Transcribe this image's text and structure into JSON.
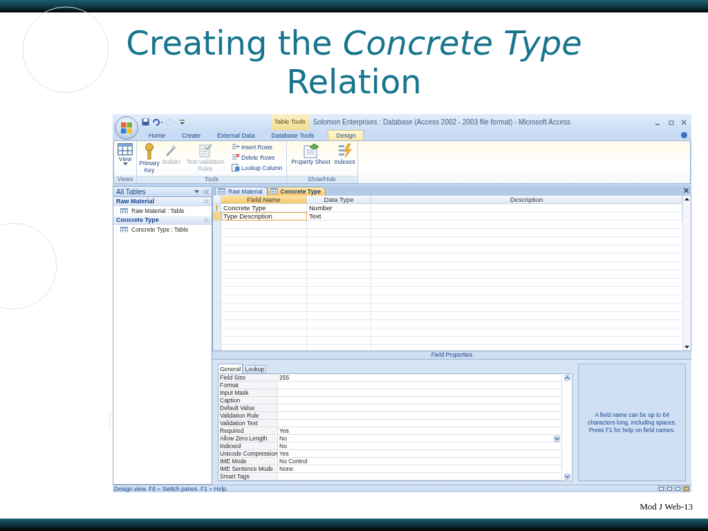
{
  "slide": {
    "title": "Creating the *Concrete Type* Relation",
    "footer": "Mod J Web-13"
  },
  "window": {
    "title": "Solomon Enterprises : Database (Access 2002 - 2003 file format) - Microsoft Access",
    "context_label": "Table Tools"
  },
  "quick_access": [
    {
      "kind": "save",
      "disabled": false
    },
    {
      "kind": "undo",
      "disabled": false
    },
    {
      "kind": "redo",
      "disabled": true
    },
    {
      "kind": "customize",
      "disabled": false
    }
  ],
  "ribbon_tabs": [
    {
      "label": "Home",
      "selected": false
    },
    {
      "label": "Create",
      "selected": false
    },
    {
      "label": "External Data",
      "selected": false
    },
    {
      "label": "Database Tools",
      "selected": false
    },
    {
      "label": "Design",
      "selected": true
    }
  ],
  "ribbon_groups": [
    {
      "label": "Views",
      "commands": [
        {
          "kind": "view",
          "label": "View",
          "disabled": false
        }
      ]
    },
    {
      "label": "Tools",
      "commands": [
        {
          "kind": "key",
          "label": "Primary Key",
          "disabled": false
        },
        {
          "kind": "builder",
          "label": "Builder",
          "disabled": true
        },
        {
          "kind": "validation",
          "label": "Test Validation Rules",
          "disabled": true
        },
        {
          "kind": "insert",
          "label": "Insert Rows",
          "disabled": false
        },
        {
          "kind": "delete",
          "label": "Delete Rows",
          "disabled": false
        },
        {
          "kind": "lookup",
          "label": "Lookup Column",
          "disabled": false
        }
      ]
    },
    {
      "label": "Show/Hide",
      "commands": [
        {
          "kind": "sheet",
          "label": "Property Sheet",
          "disabled": false
        },
        {
          "kind": "indexes",
          "label": "Indexes",
          "disabled": false
        }
      ]
    }
  ],
  "nav_pane": {
    "header": "All Tables",
    "groups": [
      {
        "label": "Raw Material",
        "expanded": true,
        "items": [
          "Raw Material : Table"
        ]
      },
      {
        "label": "Concrete Type",
        "expanded": true,
        "items": [
          "Concrete Type : Table"
        ]
      }
    ]
  },
  "document_tabs": [
    {
      "label": "Raw Material",
      "selected": false
    },
    {
      "label": "Concrete Type",
      "selected": true
    }
  ],
  "design_grid": {
    "columns": [
      {
        "label": "Field Name",
        "selected": true
      },
      {
        "label": "Data Type",
        "selected": false
      },
      {
        "label": "Description",
        "selected": false
      }
    ],
    "rows": [
      {
        "field_name": "Concrete Type",
        "data_type": "Number",
        "primary_key": true,
        "selected": false
      },
      {
        "field_name": "Type Description",
        "data_type": "Text",
        "primary_key": false,
        "selected": true
      }
    ]
  },
  "field_properties": {
    "title": "Field Properties",
    "tabs": [
      {
        "label": "General",
        "selected": true
      },
      {
        "label": "Lookup",
        "selected": false
      }
    ],
    "properties": [
      {
        "name": "Field Size",
        "value": "255",
        "dropdown": false
      },
      {
        "name": "Format",
        "dropdown": false
      },
      {
        "name": "Input Mask",
        "dropdown": false
      },
      {
        "name": "Caption",
        "dropdown": false
      },
      {
        "name": "Default Value",
        "dropdown": false
      },
      {
        "name": "Validation Rule",
        "dropdown": false
      },
      {
        "name": "Validation Text",
        "dropdown": false
      },
      {
        "name": "Required",
        "value": "Yes",
        "dropdown": false
      },
      {
        "name": "Allow Zero Length",
        "value": "No",
        "dropdown": true
      },
      {
        "name": "Indexed",
        "value": "No",
        "dropdown": false
      },
      {
        "name": "Unicode Compression",
        "value": "Yes",
        "dropdown": false
      },
      {
        "name": "IME Mode",
        "value": "No Control",
        "dropdown": false
      },
      {
        "name": "IME Sentence Mode",
        "value": "None",
        "dropdown": false
      },
      {
        "name": "Smart Tags",
        "dropdown": false
      }
    ],
    "help_text": "A field name can be up to 64 characters long, including spaces.  Press F1 for help on field names."
  },
  "status_bar": {
    "text": "Design view.  F6 = Switch panes.  F1 = Help.",
    "view_buttons": [
      {
        "selected": false
      },
      {
        "selected": false
      },
      {
        "selected": false
      },
      {
        "selected": true
      }
    ]
  }
}
